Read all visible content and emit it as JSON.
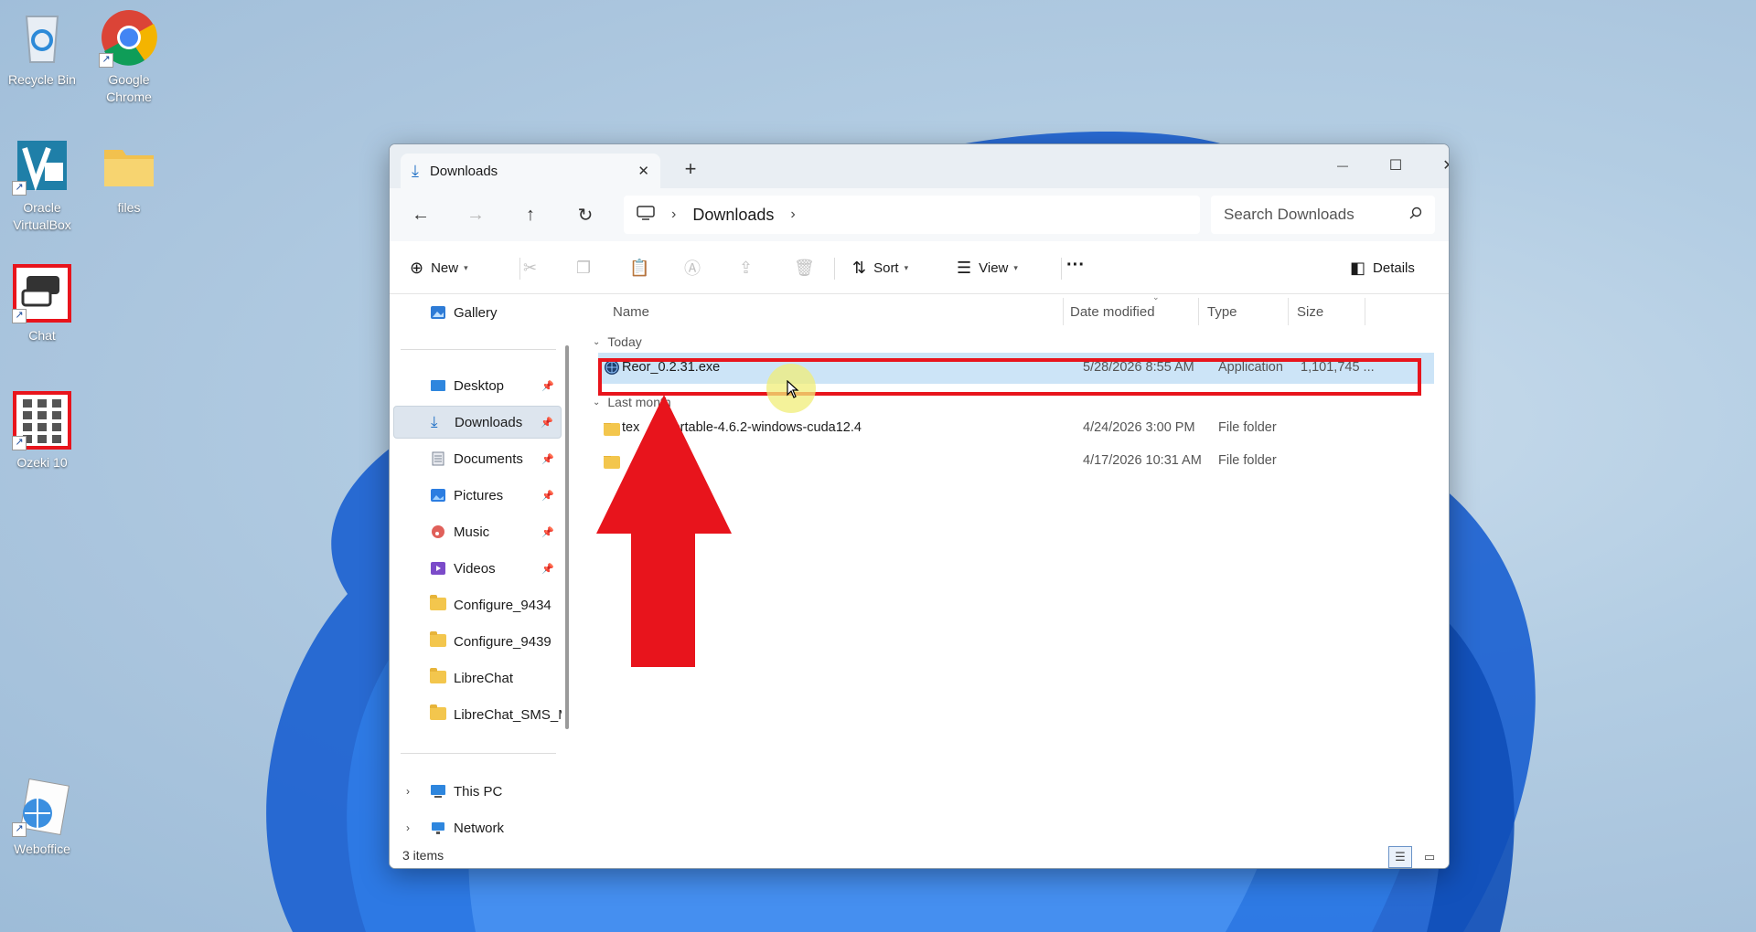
{
  "desktop": {
    "icons": [
      {
        "label": "Recycle Bin",
        "icon": "recycle-bin-icon"
      },
      {
        "label": "Google Chrome",
        "icon": "chrome-icon"
      },
      {
        "label": "Oracle VirtualBox",
        "icon": "virtualbox-icon"
      },
      {
        "label": "files",
        "icon": "folder-icon"
      },
      {
        "label": "Chat",
        "icon": "chat-icon"
      },
      {
        "label": "Ozeki 10",
        "icon": "ozeki-icon"
      },
      {
        "label": "Weboffice",
        "icon": "weboffice-icon"
      }
    ]
  },
  "window": {
    "tab_title": "Downloads",
    "new_tab": "+",
    "controls": {
      "minimize": "—",
      "maximize": "☐",
      "close": "✕"
    }
  },
  "nav": {
    "back": "←",
    "forward": "→",
    "up": "↑",
    "refresh": "↻",
    "breadcrumb": [
      "Downloads"
    ],
    "search_placeholder": "Search Downloads"
  },
  "commands": {
    "new": "New",
    "sort": "Sort",
    "view": "View",
    "more": "···",
    "details": "Details"
  },
  "sidebar": {
    "items": [
      {
        "label": "Gallery",
        "icon": "gallery-icon",
        "pinned": false
      },
      {
        "label": "Desktop",
        "icon": "desktop-icon",
        "pinned": true
      },
      {
        "label": "Downloads",
        "icon": "download-icon",
        "pinned": true,
        "selected": true
      },
      {
        "label": "Documents",
        "icon": "documents-icon",
        "pinned": true
      },
      {
        "label": "Pictures",
        "icon": "pictures-icon",
        "pinned": true
      },
      {
        "label": "Music",
        "icon": "music-icon",
        "pinned": true
      },
      {
        "label": "Videos",
        "icon": "videos-icon",
        "pinned": true
      },
      {
        "label": "Configure_9434",
        "icon": "folder-icon",
        "pinned": false
      },
      {
        "label": "Configure_9439",
        "icon": "folder-icon",
        "pinned": false
      },
      {
        "label": "LibreChat",
        "icon": "folder-icon",
        "pinned": false
      },
      {
        "label": "LibreChat_SMS_M",
        "icon": "folder-icon",
        "pinned": false
      },
      {
        "label": "This PC",
        "icon": "this-pc-icon",
        "pinned": false
      },
      {
        "label": "Network",
        "icon": "network-icon",
        "pinned": false
      }
    ]
  },
  "columns": {
    "name": "Name",
    "date": "Date modified",
    "type": "Type",
    "size": "Size"
  },
  "groups": [
    {
      "label": "Today",
      "files": [
        {
          "name": "Reor_0.2.31.exe",
          "date": "5/28/2026 8:55 AM",
          "type": "Application",
          "size": "1,101,745 ...",
          "selected": true
        }
      ]
    },
    {
      "label": "Last month",
      "files": [
        {
          "name": "text-generation-webui-portable-4.6.2-windows-cuda12.4",
          "visible_name": "tex       portable-4.6.2-windows-cuda12.4",
          "date": "4/24/2026 3:00 PM",
          "type": "File folder",
          "size": ""
        },
        {
          "name": "",
          "visible_name": "",
          "date": "4/17/2026 10:31 AM",
          "type": "File folder",
          "size": ""
        }
      ]
    }
  ],
  "status": {
    "item_count": "3 items"
  },
  "annotation": {
    "color": "#e8141c"
  }
}
